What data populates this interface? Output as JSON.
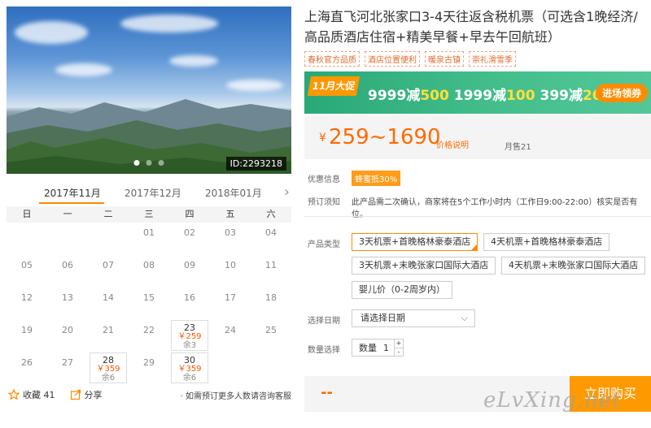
{
  "photo": {
    "id_label": "ID:2293218"
  },
  "calendar": {
    "months": [
      "2017年11月",
      "2017年12月",
      "2018年01月"
    ],
    "weekdays": [
      "日",
      "一",
      "二",
      "三",
      "四",
      "五",
      "六"
    ],
    "rows": [
      [
        "",
        "",
        "",
        "01",
        "02",
        "03",
        "04"
      ],
      [
        "05",
        "06",
        "07",
        "08",
        "09",
        "10",
        "11"
      ],
      [
        "12",
        "13",
        "14",
        "15",
        "16",
        "17",
        "18"
      ],
      [
        "19",
        "20",
        "21",
        "22",
        "23",
        "24",
        "25"
      ],
      [
        "26",
        "27",
        "28",
        "29",
        "30",
        "",
        ""
      ]
    ],
    "available": {
      "23": {
        "price": "￥259",
        "stock": "余3"
      },
      "28": {
        "price": "￥359",
        "stock": "余6"
      },
      "30": {
        "price": "￥359",
        "stock": "余6"
      }
    }
  },
  "footer": {
    "favorite_label": "收藏 41",
    "share_label": "分享",
    "note": "如需预订更多人数请咨询客服"
  },
  "product": {
    "title": "上海直飞河北张家口3-4天往返含税机票（可选含1晚经济/高品质酒店住宿+精美早餐+早去午回航班）",
    "tags": [
      "春秋官方品质",
      "酒店位置便利",
      "暖泉古镇",
      "崇礼滑雪季"
    ]
  },
  "banner": {
    "promo_label": "11月大促",
    "deals": [
      {
        "base": "9999减",
        "off": "500"
      },
      {
        "base": "1999减",
        "off": "100"
      },
      {
        "base": "399减",
        "off": "20"
      }
    ],
    "enter_label": "进场领券"
  },
  "price": {
    "currency": "¥",
    "range": "259~1690",
    "explain": "价格说明",
    "sold": "月售21"
  },
  "offers": {
    "label": "优惠信息",
    "coupon": "蜂蜜抵30%"
  },
  "notice": {
    "label": "预订须知",
    "text": "此产品需二次确认，商家将在5个工作小时内（工作日9:00-22:00）核实是否有位。"
  },
  "product_type": {
    "label": "产品类型",
    "options": [
      "3天机票+首晚格林豪泰酒店",
      "4天机票+首晚格林豪泰酒店",
      "3天机票+末晚张家口国际大酒店",
      "4天机票+末晚张家口国际大酒店",
      "婴儿价（0-2周岁内）"
    ]
  },
  "date": {
    "label": "选择日期",
    "placeholder": "请选择日期"
  },
  "quantity": {
    "label": "数量选择",
    "inner_label": "数量",
    "value": "1",
    "plus": "+",
    "minus": "-"
  },
  "buy": {
    "total": "--",
    "label": "立即购买"
  },
  "watermark": "eLvXing.net"
}
